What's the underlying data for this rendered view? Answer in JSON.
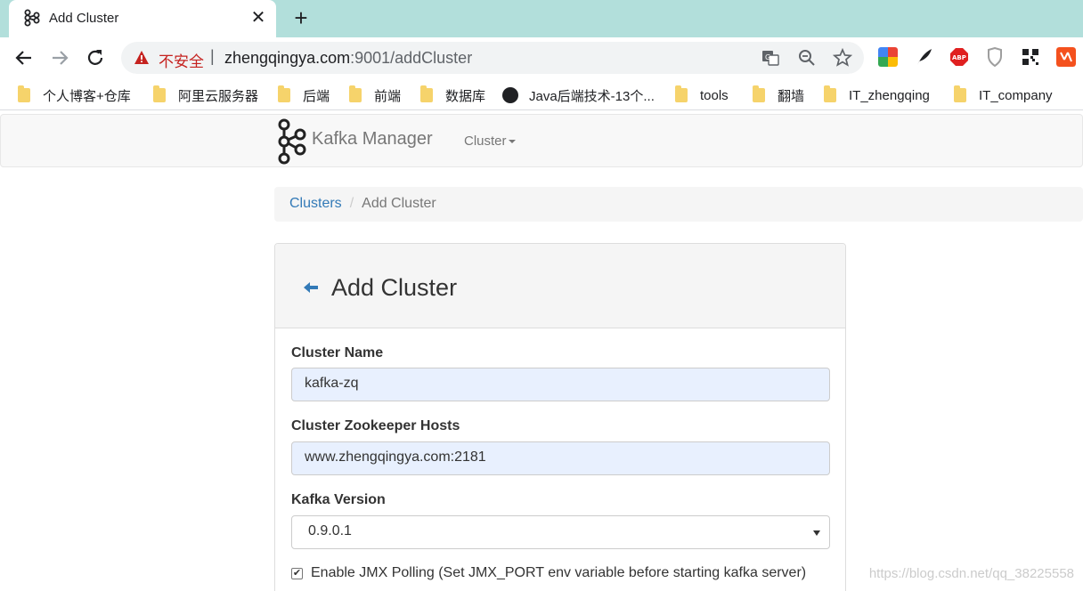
{
  "browser": {
    "tab": {
      "title": "Add Cluster",
      "close_glyph": "✕"
    },
    "new_tab_glyph": "+",
    "omnibox": {
      "security_label": "不安全",
      "separator": "|",
      "url_host": "zhengqingya.com",
      "url_rest": ":9001/addCluster"
    },
    "bookmarks": [
      {
        "label": "个人博客+仓库",
        "icon": "folder-icon"
      },
      {
        "label": "阿里云服务器",
        "icon": "folder-icon"
      },
      {
        "label": "后端",
        "icon": "folder-icon"
      },
      {
        "label": "前端",
        "icon": "folder-icon"
      },
      {
        "label": "数据库",
        "icon": "folder-icon"
      },
      {
        "label": "Java后端技术-13个...",
        "icon": "globe-icon"
      },
      {
        "label": "tools",
        "icon": "folder-icon"
      },
      {
        "label": "翻墙",
        "icon": "folder-icon"
      },
      {
        "label": "IT_zhengqing",
        "icon": "folder-icon"
      },
      {
        "label": "IT_company",
        "icon": "folder-icon"
      }
    ]
  },
  "navbar": {
    "brand": "Kafka Manager",
    "cluster_menu": "Cluster"
  },
  "breadcrumb": {
    "link": "Clusters",
    "separator": "/",
    "active": "Add Cluster"
  },
  "form": {
    "title": "Add Cluster",
    "cluster_name_label": "Cluster Name",
    "cluster_name_value": "kafka-zq",
    "zk_hosts_label": "Cluster Zookeeper Hosts",
    "zk_hosts_value": "www.zhengqingya.com:2181",
    "version_label": "Kafka Version",
    "version_value": "0.9.0.1",
    "jmx_checkbox_checked": true,
    "jmx_label": "Enable JMX Polling (Set JMX_PORT env variable before starting kafka server)"
  },
  "watermark": "https://blog.csdn.net/qq_38225558",
  "colors": {
    "tabstrip": "#b2dfdb",
    "link": "#337ab7",
    "insecure": "#c5221f",
    "autofill": "#e8f0fe"
  }
}
